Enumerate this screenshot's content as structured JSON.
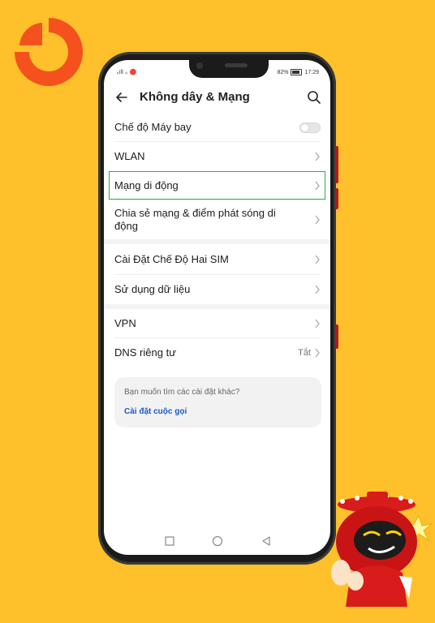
{
  "status_bar": {
    "left": "ₓill ᵢᵢ 🔴",
    "battery": "82%",
    "time": "17:29"
  },
  "app_bar": {
    "title": "Không dây & Mạng"
  },
  "settings": [
    {
      "label": "Chế độ Máy bay"
    },
    {
      "label": "WLAN"
    },
    {
      "label": "Mạng di động"
    },
    {
      "label": "Chia sẻ mạng & điểm phát sóng di động"
    },
    {
      "label": "Cài Đặt Chế Độ Hai SIM"
    },
    {
      "label": "Sử dụng dữ liệu"
    },
    {
      "label": "VPN"
    },
    {
      "label": "DNS riêng tư",
      "value": "Tắt"
    }
  ],
  "suggestion": {
    "question": "Bạn muốn tìm các cài đặt khác?",
    "link": "Cài đặt cuộc gọi"
  },
  "colors": {
    "background": "#fec02b",
    "accent": "#1a58c8",
    "highlight": "#2faa4a",
    "logo": "#f4511e"
  },
  "icons": [
    "logo-icon",
    "back-arrow-icon",
    "search-icon",
    "chevron-right-icon",
    "toggle-switch",
    "nav-back-icon",
    "nav-home-icon",
    "nav-recent-icon",
    "mascot-illustration"
  ],
  "battery_level": 0.82
}
